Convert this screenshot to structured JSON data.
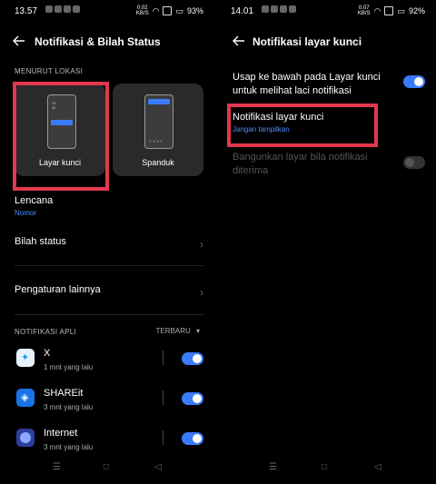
{
  "left": {
    "status": {
      "time": "13.57",
      "net": "0.02\nKB/S",
      "battery": "93%"
    },
    "header": {
      "title": "Notifikasi & Bilah Status"
    },
    "section_location": "MENURUT LOKASI",
    "cards": [
      {
        "label": "Layar kunci"
      },
      {
        "label": "Spanduk"
      }
    ],
    "lencana": {
      "title": "Lencana",
      "sub": "Nomor"
    },
    "rows": [
      {
        "label": "Bilah status"
      },
      {
        "label": "Pengaturan lainnya"
      }
    ],
    "section_apps": "NOTIFIKASI APLI",
    "sort": "TERBARU",
    "apps": [
      {
        "name": "X",
        "sub": "1 mnt yang lalu",
        "color": "#1d9bf0"
      },
      {
        "name": "SHAREit",
        "sub": "3 mnt yang lalu",
        "color": "#1a73e8"
      },
      {
        "name": "Internet",
        "sub": "3 mnt yang lalu",
        "color": "#5b7dff"
      }
    ]
  },
  "right": {
    "status": {
      "time": "14.01",
      "net": "0.07\nKB/S",
      "battery": "92%"
    },
    "header": {
      "title": "Notifikasi layar kunci"
    },
    "swipe": {
      "label": "Usap ke bawah pada Layar kunci untuk melihat laci notifikasi"
    },
    "lock_notif": {
      "label": "Notifikasi layar kunci",
      "sub": "Jangan tampilkan"
    },
    "wake": {
      "label": "Bangunkan layar bila notifikasi diterima"
    }
  },
  "colors": {
    "accent": "#3a7bfd",
    "highlight": "#e3384f",
    "link": "#4f8cff"
  },
  "icons": [
    "back-arrow-icon",
    "chevron-right-icon",
    "dropdown-triangle-icon",
    "menu-nav-icon",
    "home-nav-icon",
    "back-nav-icon"
  ]
}
